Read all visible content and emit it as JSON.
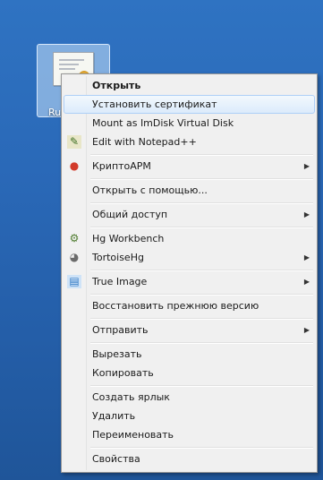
{
  "desktop": {
    "icon_label": "Ru"
  },
  "menu": {
    "items": [
      {
        "label": "Открыть",
        "bold": true
      },
      {
        "label": "Установить сертификат",
        "hover": true
      },
      {
        "label": "Mount as ImDisk Virtual Disk"
      },
      {
        "label": "Edit with Notepad++",
        "icon": "notepad-icon"
      },
      {
        "sep": true
      },
      {
        "label": "КриптоАРМ",
        "icon": "cryptoarm-icon",
        "submenu": true
      },
      {
        "sep": true
      },
      {
        "label": "Открыть с помощью..."
      },
      {
        "sep": true
      },
      {
        "label": "Общий доступ",
        "submenu": true
      },
      {
        "sep": true
      },
      {
        "label": "Hg Workbench",
        "icon": "hg-workbench-icon"
      },
      {
        "label": "TortoiseHg",
        "icon": "tortoisehg-icon",
        "submenu": true
      },
      {
        "sep": true
      },
      {
        "label": "True Image",
        "icon": "true-image-icon",
        "submenu": true
      },
      {
        "sep": true
      },
      {
        "label": "Восстановить прежнюю версию"
      },
      {
        "sep": true
      },
      {
        "label": "Отправить",
        "submenu": true
      },
      {
        "sep": true
      },
      {
        "label": "Вырезать"
      },
      {
        "label": "Копировать"
      },
      {
        "sep": true
      },
      {
        "label": "Создать ярлык"
      },
      {
        "label": "Удалить"
      },
      {
        "label": "Переименовать"
      },
      {
        "sep": true
      },
      {
        "label": "Свойства"
      }
    ]
  }
}
